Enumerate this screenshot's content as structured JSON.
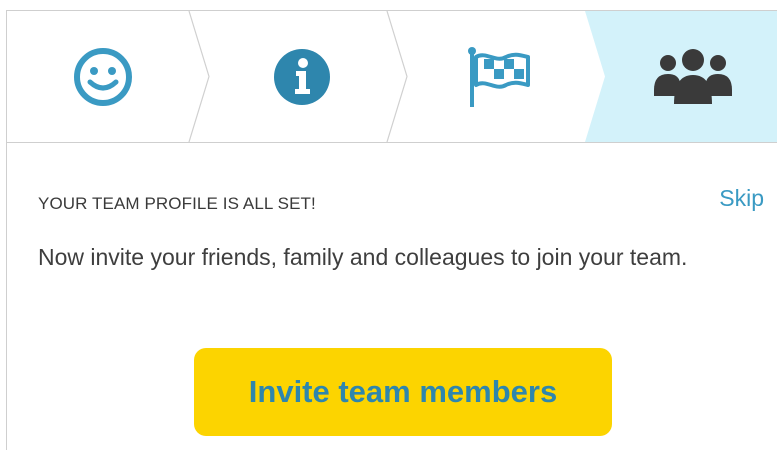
{
  "stepper": {
    "steps": [
      {
        "icon": "smiley-icon",
        "state": "done",
        "color": "#3a9ac3"
      },
      {
        "icon": "info-icon",
        "state": "done",
        "color": "#3a9ac3"
      },
      {
        "icon": "flag-icon",
        "state": "done",
        "color": "#3a9ac3"
      },
      {
        "icon": "team-icon",
        "state": "active",
        "color": "#3a3a3a"
      }
    ],
    "active_bg": "#d3f2fa",
    "divider_color": "#d0d0d0"
  },
  "main": {
    "title": "YOUR TEAM PROFILE IS ALL SET!",
    "skip_label": "Skip",
    "description": "Now invite your friends, family and colleagues to join your team.",
    "invite_label": "Invite team members"
  },
  "colors": {
    "accent": "#3a9ac3",
    "button_bg": "#fcd400",
    "text": "#3e3e3e"
  }
}
